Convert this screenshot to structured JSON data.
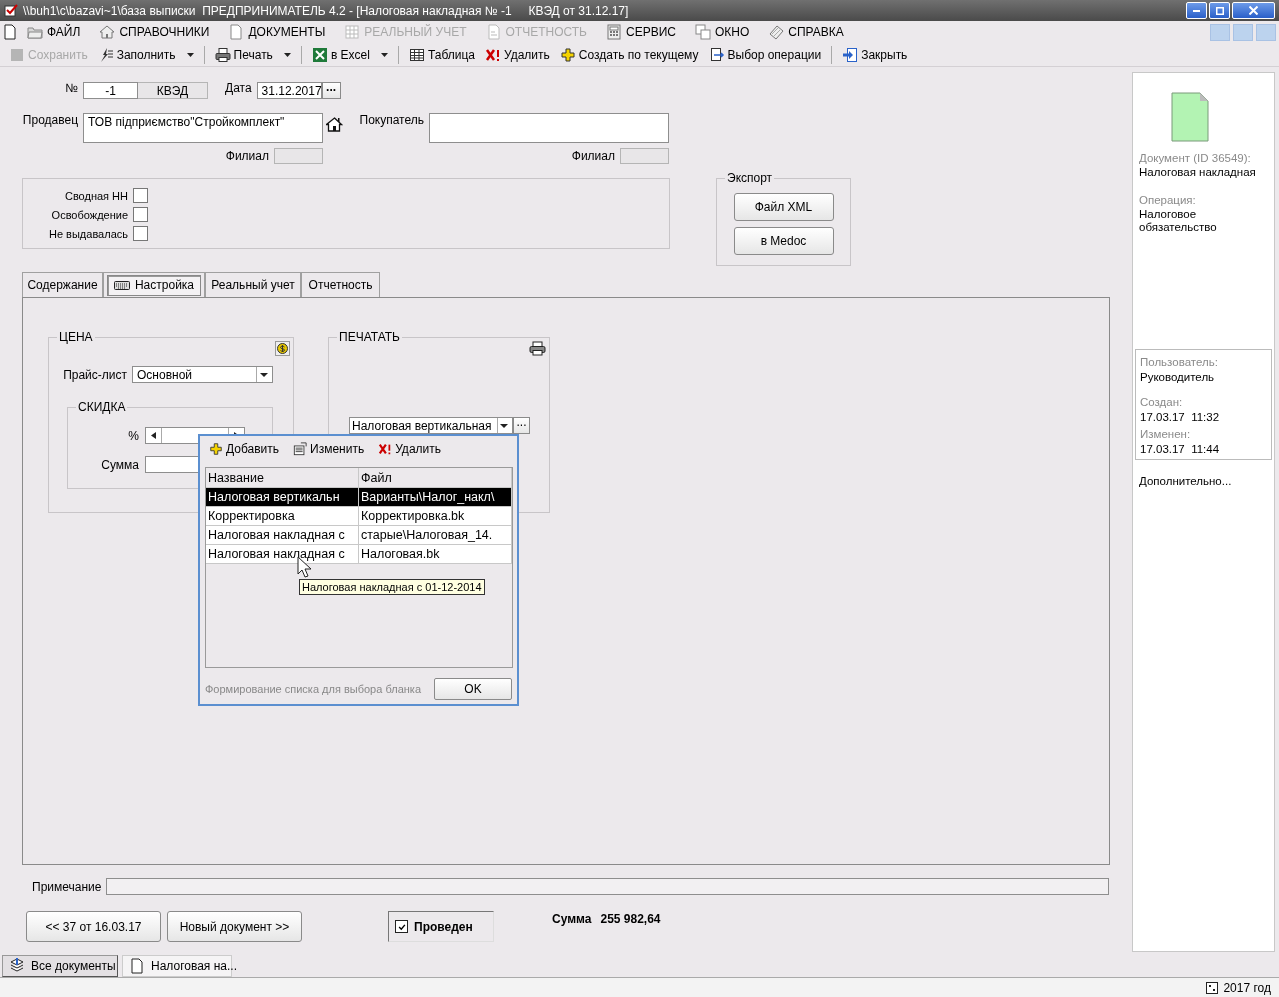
{
  "window": {
    "title": "\\\\buh1\\c\\bazavi~1\\база выписки  ПРЕДПРИНИМАТЕЛЬ 4.2 - [Налоговая накладная № -1     КВЭД от 31.12.17]"
  },
  "menu": [
    {
      "label": "ФАЙЛ",
      "disabled": false
    },
    {
      "label": "СПРАВОЧНИКИ",
      "disabled": false
    },
    {
      "label": "ДОКУМЕНТЫ",
      "disabled": false
    },
    {
      "label": "РЕАЛЬНЫЙ УЧЕТ",
      "disabled": true
    },
    {
      "label": "ОТЧЕТНОСТЬ",
      "disabled": true
    },
    {
      "label": "СЕРВИС",
      "disabled": false
    },
    {
      "label": "ОКНО",
      "disabled": false
    },
    {
      "label": "СПРАВКА",
      "disabled": false
    }
  ],
  "toolbar": [
    [
      {
        "label": "Сохранить",
        "disabled": true,
        "dropdown": false
      },
      {
        "label": "Заполнить",
        "disabled": false,
        "dropdown": true
      }
    ],
    [
      {
        "label": "Печать",
        "disabled": false,
        "dropdown": true
      }
    ],
    [
      {
        "label": "в Excel",
        "disabled": false,
        "dropdown": true
      }
    ],
    [
      {
        "label": "Таблица",
        "disabled": false,
        "dropdown": false
      },
      {
        "label": "Удалить",
        "disabled": false,
        "dropdown": false
      },
      {
        "label": "Создать по текущему",
        "disabled": false,
        "dropdown": false
      },
      {
        "label": "Выбор операции",
        "disabled": false,
        "dropdown": false
      }
    ],
    [
      {
        "label": "Закрыть",
        "disabled": false,
        "dropdown": false
      }
    ]
  ],
  "header": {
    "number_label": "№",
    "number": "-1",
    "kved": "КВЭД",
    "date_label": "Дата",
    "date": "31.12.2017",
    "date_button": "...",
    "seller_label": "Продавец",
    "seller": "ТОВ підприємство\"Стройкомплект\"",
    "buyer_label": "Покупатель",
    "branch_labels": [
      "Филиал",
      "Филиал"
    ]
  },
  "flags": [
    {
      "label": "Сводная НН",
      "checked": false
    },
    {
      "label": "Освобождение",
      "checked": false
    },
    {
      "label": "Не выдавалась",
      "checked": false
    }
  ],
  "export": {
    "title": "Экспорт",
    "buttons": [
      "Файл XML",
      "в Medoc"
    ]
  },
  "tabs": [
    {
      "label": "Содержание",
      "selected": false
    },
    {
      "label": "Настройка",
      "selected": true
    },
    {
      "label": "Реальный учет",
      "selected": false
    },
    {
      "label": "Отчетность",
      "selected": false
    }
  ],
  "price": {
    "title": "ЦЕНА",
    "price_list_label": "Прайс-лист",
    "price_list": "Основной",
    "discount": {
      "title": "СКИДКА",
      "percent_label": "%",
      "sum_label": "Сумма"
    }
  },
  "print": {
    "title": "ПЕЧАТАТЬ",
    "form": "Налоговая вертикальная",
    "more_button": "..."
  },
  "dialog": {
    "toolbar": [
      "Добавить",
      "Изменить",
      "Удалить"
    ],
    "columns": [
      "Название",
      "Файл"
    ],
    "rows": [
      {
        "cells": [
          "Налоговая вертикальн",
          "Варианты\\Налог_накл\\"
        ],
        "selected": true
      },
      {
        "cells": [
          "Корректировка",
          "Корректировка.bk"
        ],
        "selected": false
      },
      {
        "cells": [
          "Налоговая накладная с",
          "старые\\Налоговая_14."
        ],
        "selected": false
      },
      {
        "cells": [
          "Налоговая накладная с",
          "Налоговая.bk"
        ],
        "selected": false
      }
    ],
    "hint": "Формирование списка для выбора бланка",
    "ok": "OK"
  },
  "tooltip": "Налоговая накладная с 01-12-2014",
  "note": {
    "label": "Примечание"
  },
  "nav_buttons": [
    "<< 37 от 16.03.17",
    "Новый документ >>"
  ],
  "posted": {
    "label": "Проведен",
    "checked": true
  },
  "total": {
    "label": "Сумма",
    "value": "255 982,64"
  },
  "info": {
    "doc_label": "Документ  (ID 36549):",
    "doc": "Налоговая накладная",
    "op_label": "Операция:",
    "op": "Налоговое обязательство",
    "user_label": "Пользователь:",
    "user": "Руководитель",
    "created_label": "Создан:",
    "created": "17.03.17  11:32",
    "modified_label": "Изменен:",
    "modified": "17.03.17  11:44",
    "more": "Дополнительно..."
  },
  "taskbar": [
    {
      "label": "Все документы",
      "selected": false
    },
    {
      "label": "Налоговая на...",
      "selected": true
    }
  ],
  "status_bar": {
    "year": "2017 год"
  }
}
